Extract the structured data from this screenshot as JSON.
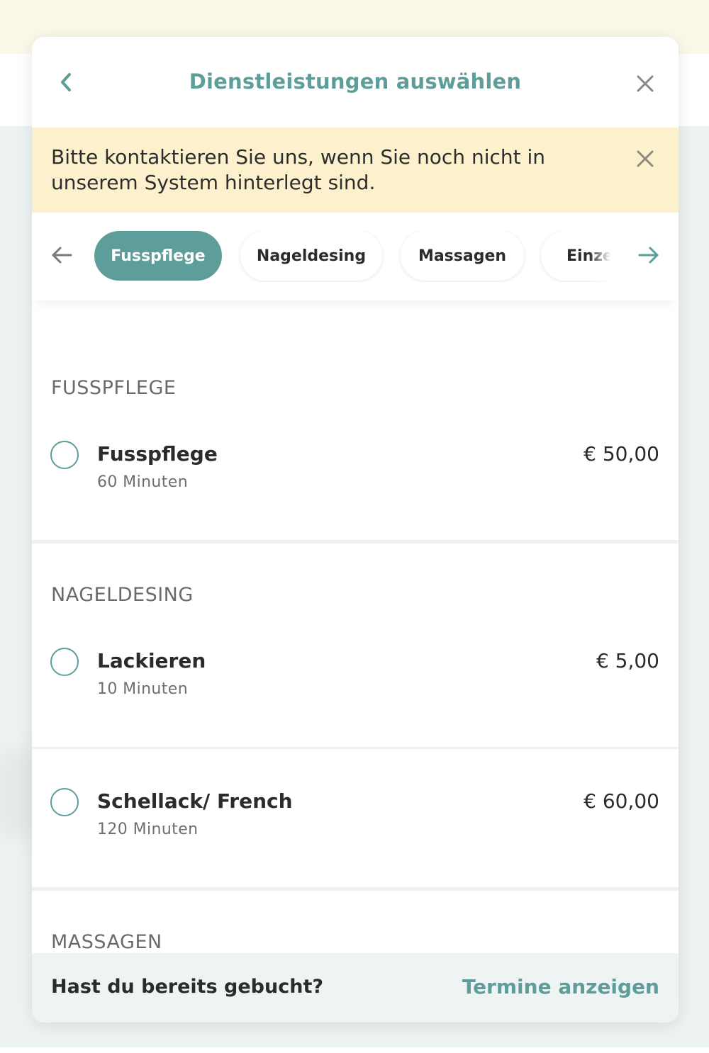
{
  "header": {
    "title": "Dienstleistungen auswählen",
    "back_icon": "chevron-left-icon",
    "close_icon": "close-icon"
  },
  "notice": {
    "text": "Bitte kontaktieren Sie uns, wenn Sie noch nicht in unserem System hinterlegt sind."
  },
  "tabs": [
    {
      "label": "Fusspflege",
      "active": true
    },
    {
      "label": "Nageldesing",
      "active": false
    },
    {
      "label": "Massagen",
      "active": false
    },
    {
      "label": "Einzel E",
      "active": false
    }
  ],
  "sections": [
    {
      "heading": "FUSSPFLEGE",
      "services": [
        {
          "name": "Fusspflege",
          "duration": "60 Minuten",
          "price": "€ 50,00"
        }
      ]
    },
    {
      "heading": "NAGELDESING",
      "services": [
        {
          "name": "Lackieren",
          "duration": "10 Minuten",
          "price": "€ 5,00"
        },
        {
          "name": "Schellack/ French",
          "duration": "120 Minuten",
          "price": "€ 60,00"
        }
      ]
    },
    {
      "heading": "MASSAGEN",
      "services": []
    }
  ],
  "footer": {
    "question": "Hast du bereits gebucht?",
    "link": "Termine anzeigen"
  },
  "colors": {
    "accent": "#5e9e9a",
    "notice_bg": "#fcf1cc",
    "footer_bg": "#eef4f4"
  }
}
